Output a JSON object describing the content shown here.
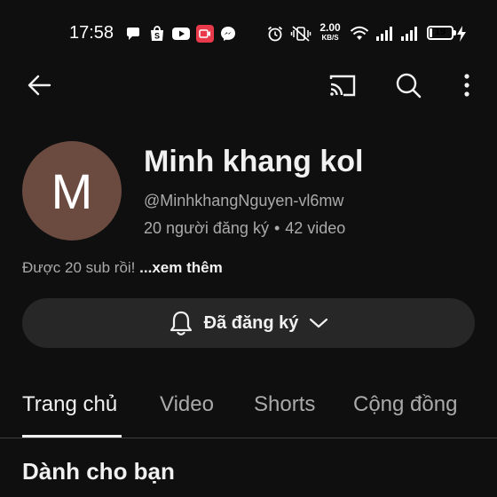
{
  "status_bar": {
    "time": "17:58",
    "net_speed_value": "2.00",
    "net_speed_unit": "KB/S",
    "battery": "19",
    "battery_level": 0.19,
    "icons": [
      "chat-icon",
      "shopee-icon",
      "youtube-icon",
      "screen-record-icon",
      "messenger-icon",
      "alarm-icon",
      "vibrate-icon",
      "wifi-icon",
      "signal-icon",
      "signal-icon",
      "charging-icon"
    ]
  },
  "top_bar": {
    "icons": [
      "back-arrow-icon",
      "cast-icon",
      "search-icon",
      "more-vertical-icon"
    ]
  },
  "channel": {
    "avatar_letter": "M",
    "avatar_color": "#6b4a40",
    "name": "Minh khang kol",
    "handle": "@MinhkhangNguyen-vl6mw",
    "subscribers": "20 người đăng ký",
    "separator": "•",
    "videos": "42 video",
    "description": "Được 20 sub rồi!",
    "more_label": "...xem thêm"
  },
  "subscribe_button": {
    "label": "Đã đăng ký"
  },
  "tabs": [
    {
      "label": "Trang chủ",
      "active": true
    },
    {
      "label": "Video",
      "active": false
    },
    {
      "label": "Shorts",
      "active": false
    },
    {
      "label": "Cộng đồng",
      "active": false
    }
  ],
  "section": {
    "title": "Dành cho bạn"
  },
  "colors": {
    "background": "#0f0f0f",
    "text_primary": "#f1f1f1",
    "text_secondary": "#aaaaaa",
    "button_bg": "#272727"
  }
}
